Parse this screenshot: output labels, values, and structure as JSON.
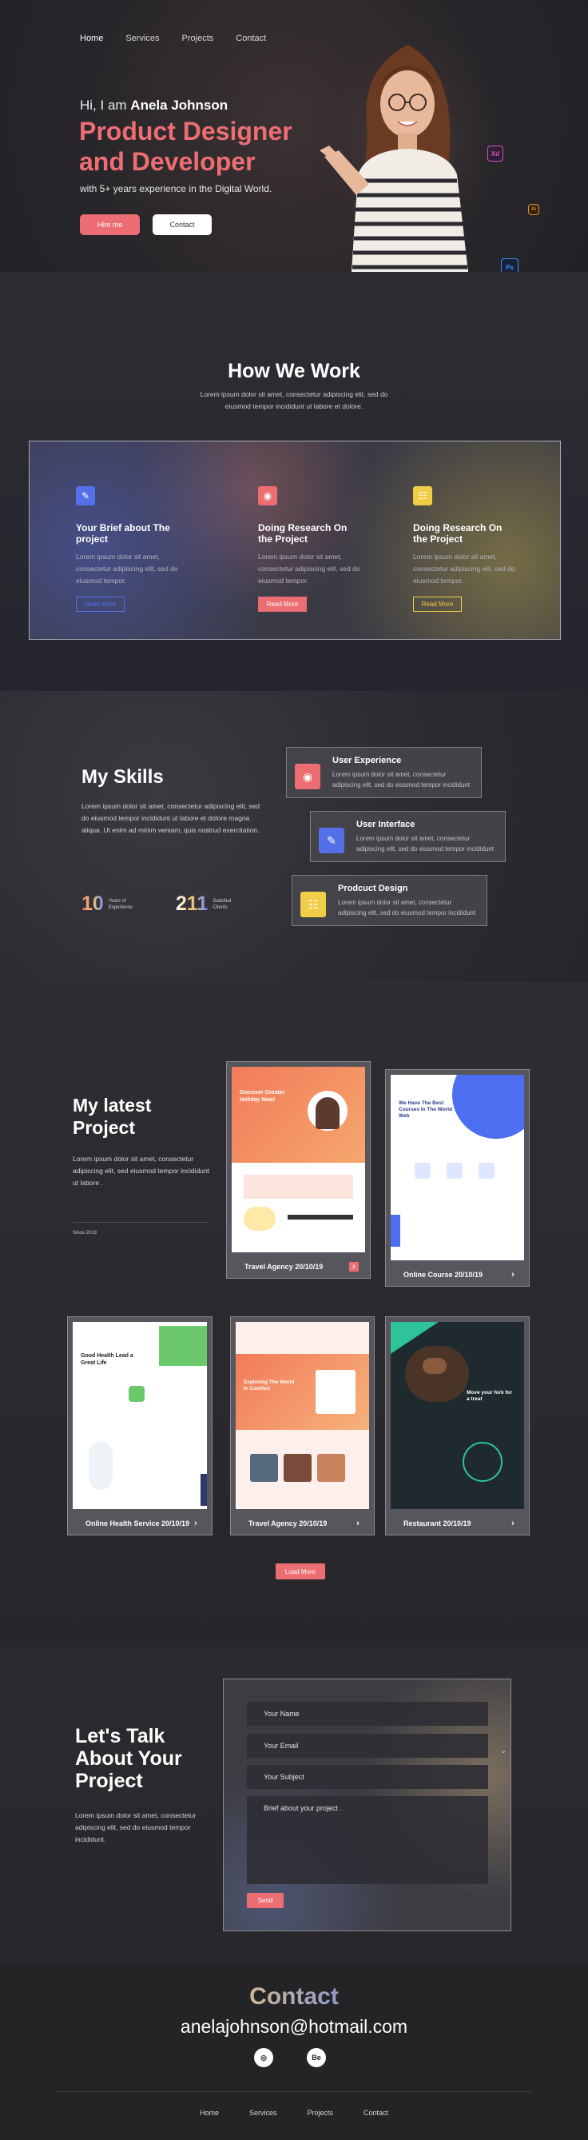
{
  "nav": {
    "items": [
      "Home",
      "Services",
      "Projects",
      "Contact"
    ]
  },
  "hero": {
    "greeting": "Hi, I am ",
    "name": "Anela Johnson",
    "title_line1": "Product Designer",
    "title_line2": "and Developer",
    "experience": "with 5+ years experience in the Digital World.",
    "hire_label": "Hire me",
    "contact_label": "Contact",
    "app_icons": [
      "Xd",
      "Ps",
      "Ai"
    ]
  },
  "how": {
    "title": "How We Work",
    "subtitle": "Lorem ipsum dolor sit amet, consectetur adipiscing elit, sed do eiusmod tempor incididunt ut labore et dolore.",
    "steps": [
      {
        "title": "Your Brief about The project",
        "text": "Lorem ipsum dolor sit amet, consectetur adipiscing elit, sed do eiusmod tempor.",
        "button": "Read More",
        "color": "#5470e8"
      },
      {
        "title": "Doing Research On the Project",
        "text": "Lorem ipsum dolor sit amet, consectetur adipiscing elit, sed do eiusmod tempor.",
        "button": "Read More",
        "color": "#ec6e72"
      },
      {
        "title": "Doing Research On the Project",
        "text": "Lorem ipsum dolor sit amet, consectetur adipiscing elit, sed do eiusmod tempor.",
        "button": "Read More",
        "color": "#f2cd47"
      }
    ]
  },
  "skills": {
    "title": "My Skills",
    "text": "Lorem ipsum dolor sit amet, consectetur adipiscing elit, sed do eiusmod tempor incididunt ut labore et dolore magna aliqua. Ut enim ad minim veniam, quis nostrud exercitation.",
    "stats": [
      {
        "number": "10",
        "label_line1": "Years of",
        "label_line2": "Experience"
      },
      {
        "number": "211",
        "label_line1": "Satisfied",
        "label_line2": "Clients"
      }
    ],
    "cards": [
      {
        "title": "User Experience",
        "text": "Lorem ipsum dolor sit amet, consectetur adipiscing elit, sed do eiusmod tempor incididunt",
        "color": "#ec6e72"
      },
      {
        "title": "User Interface",
        "text": "Lorem ipsum dolor sit amet, consectetur adipiscing elit, sed do eiusmod tempor incididunt",
        "color": "#5470e8"
      },
      {
        "title": "Prodcuct Design",
        "text": "Lorem ipsum dolor sit amet, consectetur adipiscing elit, sed do eiusmod tempor incididunt",
        "color": "#f2cd47"
      }
    ]
  },
  "projects": {
    "title": "My latest Project",
    "text": "Lorem ipsum dolor sit amet, consectetur adipiscing elit, sed eiusmod tempor incididunt ut labore .",
    "since": "Since 2013",
    "items": [
      {
        "caption": "Travel Agency 20/10/19"
      },
      {
        "caption": "Online Course 20/10/19"
      },
      {
        "caption": "Online Health Service 20/10/19"
      },
      {
        "caption": "Travel Agency 20/10/19"
      },
      {
        "caption": "Restaurant 20/10/19"
      }
    ],
    "shots": {
      "travel_headline": "Discover Greater Holiday Now!",
      "course_headline": "We Have The Best Courses In The World Web",
      "health_headline": "Good Health Lead a Great Life",
      "travel2_headline": "Exploring The World In Comfort",
      "restaurant_headline": "Move your fork for a treat"
    },
    "load_more": "Load More"
  },
  "form": {
    "title": "Let's Talk About Your Project",
    "text": "Lorem ipsum dolor sit amet, consectetur adipiscing elit, sed do eiusmod tempor incididunt.",
    "name_placeholder": "Your Name",
    "email_placeholder": "Your Email",
    "subject_placeholder": "Your Subject",
    "message_placeholder": "Brief about your project .",
    "send_label": "Send"
  },
  "footer": {
    "heading": "Contact",
    "email": "anelajohnson@hotmail.com",
    "nav": [
      "Home",
      "Services",
      "Projects",
      "Contact"
    ]
  }
}
